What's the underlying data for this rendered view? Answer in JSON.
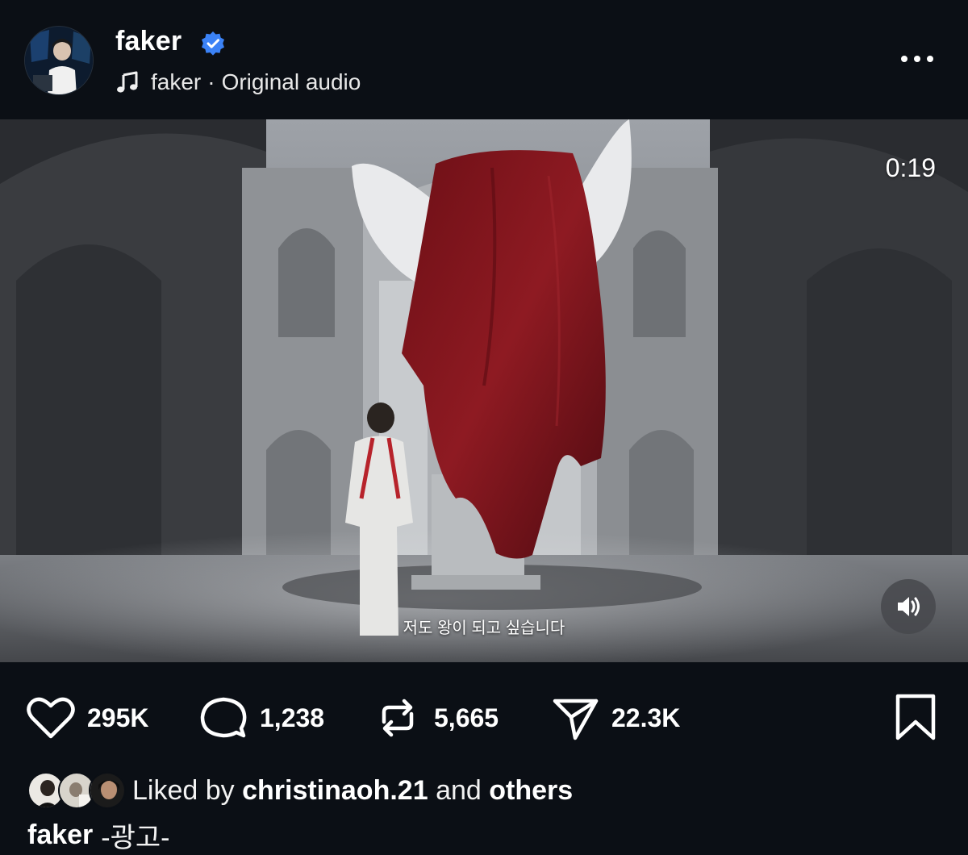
{
  "post": {
    "username": "faker",
    "verified": true,
    "audio_author": "faker",
    "audio_separator": "·",
    "audio_title": "Original audio",
    "more_icon": "more-horizontal-icon"
  },
  "video": {
    "duration": "0:19",
    "subtitle": "저도 왕이 되고 싶습니다",
    "muted_icon": "speaker-icon"
  },
  "actions": {
    "likes": "295K",
    "comments": "1,238",
    "reposts": "5,665",
    "shares": "22.3K"
  },
  "liked_by": {
    "prefix": "Liked by",
    "user": "christinaoh.21",
    "joiner": "and",
    "others": "others"
  },
  "caption": {
    "user": "faker",
    "text": "-광고-"
  },
  "colors": {
    "background": "#0b0f15",
    "verified_badge": "#3b82f6",
    "text": "#ffffff"
  }
}
